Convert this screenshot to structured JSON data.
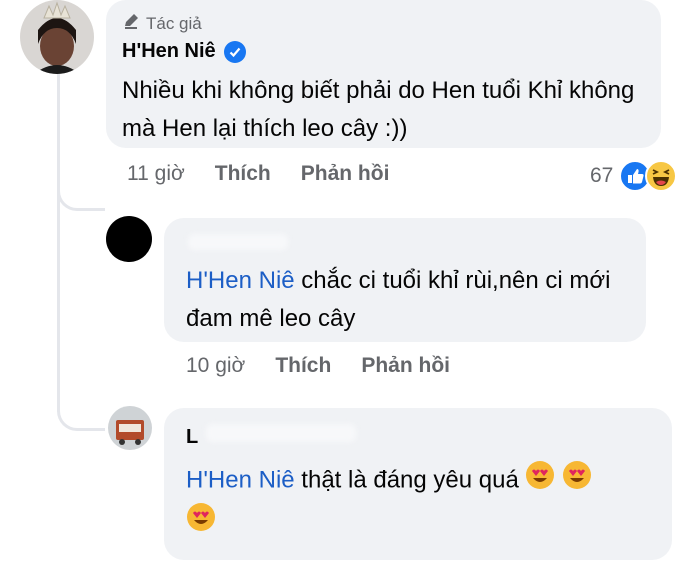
{
  "comments": [
    {
      "author_badge": "Tác giả",
      "author_name": "H'Hen Niê",
      "verified": true,
      "text": "Nhiều khi không biết phải do Hen tuổi Khỉ không mà Hen lại thích leo cây :))",
      "time": "11 giờ",
      "like_label": "Thích",
      "reply_label": "Phản hồi",
      "reaction_count": "67",
      "reaction_icons": [
        "like-icon",
        "haha-icon"
      ]
    }
  ],
  "replies": [
    {
      "author_name_visible": "",
      "mention": "H'Hen Niê",
      "text": "chắc ci tuổi khỉ rùi,nên ci mới đam mê leo cây",
      "time": "10 giờ",
      "like_label": "Thích",
      "reply_label": "Phản hồi"
    },
    {
      "author_name_visible": "L",
      "mention": "H'Hen Niê",
      "text": "thật là đáng yêu quá",
      "emojis": [
        "heart-eyes-emoji",
        "heart-eyes-emoji",
        "heart-eyes-emoji"
      ]
    }
  ],
  "colors": {
    "bubble_bg": "#f0f2f5",
    "mention": "#1c5ec6",
    "meta": "#65676b",
    "verified": "#1877f2"
  }
}
